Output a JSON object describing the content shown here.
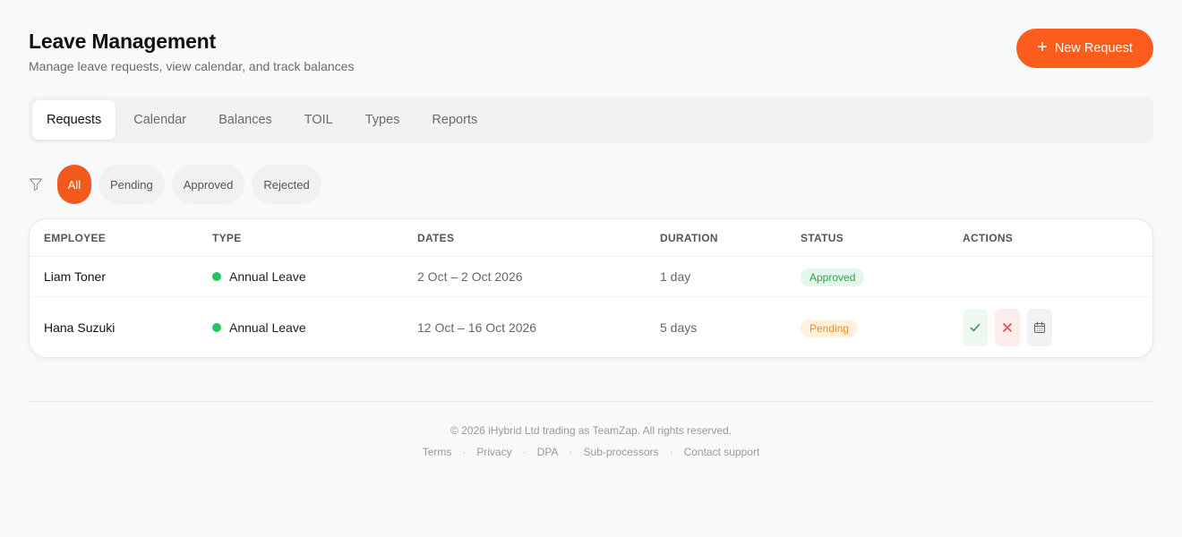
{
  "header": {
    "title": "Leave Management",
    "subtitle": "Manage leave requests, view calendar, and track balances",
    "new_button_label": "New Request",
    "new_button_icon": "plus-icon"
  },
  "tabs": [
    {
      "label": "Requests",
      "active": true
    },
    {
      "label": "Calendar",
      "active": false
    },
    {
      "label": "Balances",
      "active": false
    },
    {
      "label": "TOIL",
      "active": false
    },
    {
      "label": "Types",
      "active": false
    },
    {
      "label": "Reports",
      "active": false
    }
  ],
  "filters": {
    "icon": "filter-icon",
    "chips": [
      {
        "label": "All",
        "active": true
      },
      {
        "label": "Pending",
        "active": false
      },
      {
        "label": "Approved",
        "active": false
      },
      {
        "label": "Rejected",
        "active": false
      }
    ]
  },
  "table": {
    "columns": [
      "EMPLOYEE",
      "TYPE",
      "DATES",
      "DURATION",
      "STATUS",
      "ACTIONS"
    ],
    "rows": [
      {
        "employee": "Liam Toner",
        "type": "Annual Leave",
        "type_color": "#22c55e",
        "dates": "2 Oct – 2 Oct 2026",
        "duration": "1 day",
        "status": "Approved",
        "actions": []
      },
      {
        "employee": "Hana Suzuki",
        "type": "Annual Leave",
        "type_color": "#22c55e",
        "dates": "12 Oct – 16 Oct 2026",
        "duration": "5 days",
        "status": "Pending",
        "actions": [
          "check-icon",
          "x-icon",
          "calendar-icon"
        ]
      }
    ]
  },
  "footer": {
    "copyright": "© 2026 iHybrid Ltd trading as TeamZap. All rights reserved.",
    "links": [
      "Terms",
      "Privacy",
      "DPA",
      "Sub-processors",
      "Contact support"
    ],
    "separator": "·"
  },
  "colors": {
    "accent": "#fc5c1c",
    "approved_text": "#2aa34a",
    "pending_text": "#e6922a",
    "leave_dot": "#22c55e"
  }
}
